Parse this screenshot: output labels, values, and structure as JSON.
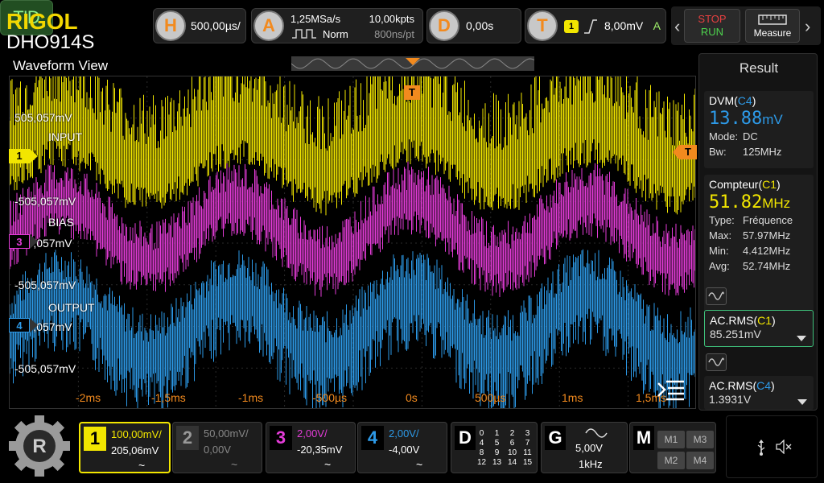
{
  "brand": {
    "logo": "RIGOL",
    "model": "DHO914S"
  },
  "view_label": "Waveform View",
  "top_bar": {
    "trigger_mode": "T'D",
    "horizontal": {
      "key": "H",
      "scale": "500,00µs/"
    },
    "acquire": {
      "key": "A",
      "sample_rate": "1,25MSa/s",
      "mode": "Norm",
      "points": "10,00kpts",
      "per_point": "800ns/pt"
    },
    "delay": {
      "key": "D",
      "value": "0,00s"
    },
    "trigger": {
      "key": "T",
      "source": "1",
      "level": "8,00mV",
      "coupling": "A"
    },
    "stop_label": "STOP",
    "run_label": "RUN",
    "measure_label": "Measure"
  },
  "waveform": {
    "channel_markers": [
      {
        "id": "1"
      },
      {
        "id": "3"
      },
      {
        "id": "4"
      }
    ],
    "trigger_marker": "T",
    "labels": {
      "input": "INPUT",
      "bias": "BIAS",
      "output": "OUTPUT",
      "l1": "505,057mV",
      "l2": "-505,057mV",
      "l3": "505,057mV",
      "l4": "-505,057mV",
      "l5": "505,057mV",
      "l6": "-505,057mV"
    },
    "x_ticks": [
      "-2ms",
      "-1,5ms",
      "-1ms",
      "-500µs",
      "0s",
      "500µs",
      "1ms",
      "1,5ms"
    ]
  },
  "result": {
    "title": "Result",
    "dvm": {
      "name": "DVM",
      "src": "C4",
      "value": "13.88",
      "unit": "mV",
      "mode_k": "Mode:",
      "mode_v": "DC",
      "bw_k": "Bw:",
      "bw_v": "125MHz"
    },
    "counter": {
      "name": "Compteur",
      "src": "C1",
      "value": "51.82",
      "unit": "MHz",
      "rows": [
        {
          "k": "Type:",
          "v": "Fréquence"
        },
        {
          "k": "Max:",
          "v": "57.97MHz"
        },
        {
          "k": "Min:",
          "v": "4.412MHz"
        },
        {
          "k": "Avg:",
          "v": "52.74MHz"
        }
      ]
    },
    "acrms1": {
      "name": "AC.RMS",
      "src": "C1",
      "value": "85.251mV"
    },
    "acrms4": {
      "name": "AC.RMS",
      "src": "C4",
      "value": "1.3931V"
    }
  },
  "bottom_bar": {
    "ch1": {
      "num": "1",
      "scale": "100,00mV/",
      "offset": "205,06mV",
      "coupling": "~"
    },
    "ch2": {
      "num": "2",
      "scale": "50,00mV/",
      "offset": "0,00V",
      "coupling": "~"
    },
    "ch3": {
      "num": "3",
      "scale": "2,00V/",
      "offset": "-20,35mV",
      "coupling": "~"
    },
    "ch4": {
      "num": "4",
      "scale": "2,00V/",
      "offset": "-4,00V",
      "coupling": "~"
    },
    "digital": {
      "key": "D",
      "grid": [
        "0",
        "1",
        "2",
        "3",
        "4",
        "5",
        "6",
        "7",
        "8",
        "9",
        "10",
        "11",
        "12",
        "13",
        "14",
        "15"
      ]
    },
    "generator": {
      "key": "G",
      "amplitude": "5,00V",
      "frequency": "1kHz"
    },
    "math": {
      "key": "M",
      "m1": "M1",
      "m2": "M2",
      "m3": "M3",
      "m4": "M4"
    }
  },
  "colors": {
    "ch1": "#f2e600",
    "ch3": "#e43cd8",
    "ch4": "#2d9ae8",
    "trigger": "#f28a1e",
    "accent_green": "#3ec07a"
  }
}
